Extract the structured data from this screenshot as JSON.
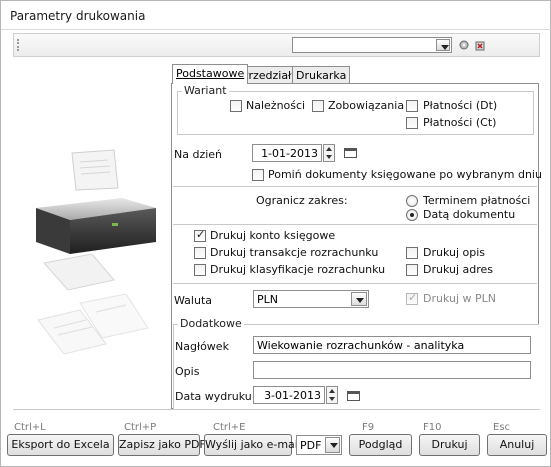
{
  "window": {
    "title": "Parametry drukowania"
  },
  "tabs": [
    {
      "label": "Podstawowe",
      "active": true
    },
    {
      "label": "Przedziały",
      "active": false
    },
    {
      "label": "Drukarka",
      "active": false
    }
  ],
  "wariant": {
    "legend": "Wariant",
    "naleznosci": {
      "label": "Należności",
      "checked": false
    },
    "zobowiazania": {
      "label": "Zobowiązania",
      "checked": false
    },
    "platnosci_dt": {
      "label": "Płatności (Dt)",
      "checked": false
    },
    "platnosci_ct": {
      "label": "Płatności (Ct)",
      "checked": false
    }
  },
  "na_dzien": {
    "label": "Na dzień",
    "value": "1-01-2013",
    "pomin_label": "Pomiń dokumenty księgowane po wybranym dniu",
    "pomin_checked": false
  },
  "zakres": {
    "label": "Ogranicz zakres:",
    "option1": "Terminem płatności",
    "option2": "Datą dokumentu",
    "selected": "Datą dokumentu"
  },
  "opcje": {
    "konto": {
      "label": "Drukuj konto księgowe",
      "checked": true
    },
    "transakcje": {
      "label": "Drukuj transakcje rozrachunku",
      "checked": false
    },
    "klasyfikacje": {
      "label": "Drukuj klasyfikacje rozrachunku",
      "checked": false
    },
    "opis": {
      "label": "Drukuj opis",
      "checked": false
    },
    "adres": {
      "label": "Drukuj adres",
      "checked": false
    }
  },
  "waluta": {
    "label": "Waluta",
    "value": "PLN",
    "drukuj_pln_label": "Drukuj w PLN",
    "drukuj_pln_checked": true
  },
  "dodatkowe": {
    "legend": "Dodatkowe",
    "naglowek_label": "Nagłówek",
    "naglowek_value": "Wiekowanie rozrachunków - analityka",
    "opis_label": "Opis",
    "opis_value": "",
    "data_label": "Data wydruku",
    "data_value": "3-01-2013"
  },
  "footer": {
    "hotkeys": {
      "excel": "Ctrl+L",
      "pdf": "Ctrl+P",
      "email": "Ctrl+E",
      "preview": "F9",
      "print": "F10",
      "cancel": "Esc"
    },
    "buttons": {
      "excel": "Eksport do Excela",
      "pdf": "Zapisz jako PDF",
      "email": "Wyślij jako e-mail",
      "format": "PDF",
      "preview": "Podgląd",
      "print": "Drukuj",
      "cancel": "Anuluj"
    }
  }
}
